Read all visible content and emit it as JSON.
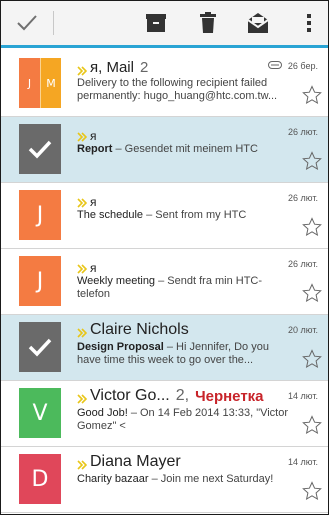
{
  "toolbar": {
    "check_icon": "check-icon",
    "archive_icon": "archive-icon",
    "delete_icon": "trash-icon",
    "read_icon": "mark-read-icon",
    "more_icon": "more-vert-icon",
    "accent": "#2aa4d4"
  },
  "messages": [
    {
      "avatar_halves": [
        "J",
        "M"
      ],
      "avatar_colors": [
        "#f47b42",
        "#f5a623"
      ],
      "sender": "я, Mail",
      "count": "2",
      "date": "26 бер.",
      "has_attachment": true,
      "subject": "",
      "preview": "Delivery to the following recipient failed permanently: hugo_huang@htc.com.tw...",
      "selected": false
    },
    {
      "avatar": "check",
      "sender": "я",
      "date": "26 лют.",
      "subject": "Report",
      "preview": " – Gesendet mit meinem HTC",
      "selected": true
    },
    {
      "avatar": "J",
      "avatar_color": "#f47b42",
      "sender": "я",
      "date": "26 лют.",
      "subject": "The schedule",
      "preview": " – Sent from my HTC",
      "selected": false
    },
    {
      "avatar": "J",
      "avatar_color": "#f47b42",
      "sender": "я",
      "date": "26 лют.",
      "subject": "Weekly meeting",
      "preview": " – Sendt fra min HTC-telefon",
      "selected": false
    },
    {
      "avatar": "check",
      "sender": "Claire Nichols",
      "date": "20 лют.",
      "subject": "Design Proposal",
      "preview": " – Hi Jennifer, Do you have time this week to go over the...",
      "selected": true
    },
    {
      "avatar": "V",
      "avatar_color": "#4cba5c",
      "sender": "Victor Go...",
      "count": "2,",
      "draft": "Чернетка",
      "date": "14 лют.",
      "subject": "Good Job!",
      "preview": " – On 14 Feb 2014 13:33, \"Victor Gomez\" <",
      "selected": false
    },
    {
      "avatar": "D",
      "avatar_color": "#e0475a",
      "sender": "Diana Mayer",
      "date": "14 лют.",
      "subject": "Charity bazaar",
      "preview": " – Join me next Saturday!",
      "selected": false
    }
  ]
}
